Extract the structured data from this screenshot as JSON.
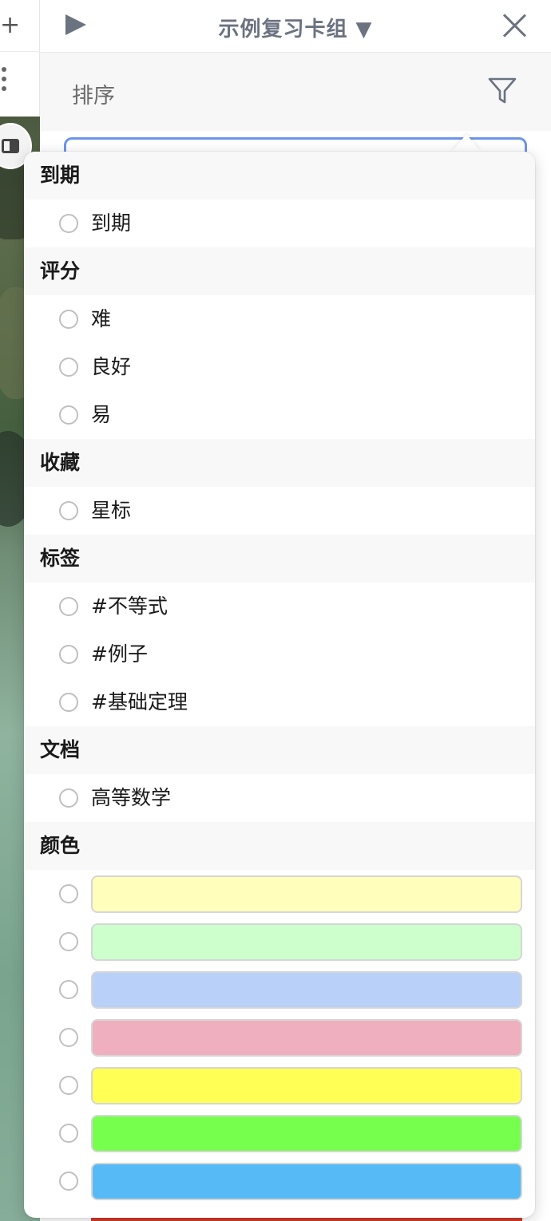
{
  "header": {
    "title": "示例复习卡组 ▼"
  },
  "sort_bar": {
    "label": "排序"
  },
  "groups": [
    {
      "title": "到期",
      "options": [
        "到期"
      ]
    },
    {
      "title": "评分",
      "options": [
        "难",
        "良好",
        "易"
      ]
    },
    {
      "title": "收藏",
      "options": [
        "星标"
      ]
    },
    {
      "title": "标签",
      "options": [
        "#不等式",
        "#例子",
        "#基础定理"
      ]
    },
    {
      "title": "文档",
      "options": [
        "高等数学"
      ]
    }
  ],
  "colors": {
    "title": "颜色",
    "swatches": [
      "#ffffbb",
      "#ccffcc",
      "#b9d0f8",
      "#f0afbe",
      "#ffff55",
      "#77ff4e",
      "#56baf7"
    ]
  },
  "icons": {
    "left_top": "plus-icon",
    "left_more": "more-vertical-icon",
    "panel_toggle": "sidebar-toggle-icon",
    "play": "play-icon",
    "close": "close-icon",
    "filter": "filter-icon"
  }
}
